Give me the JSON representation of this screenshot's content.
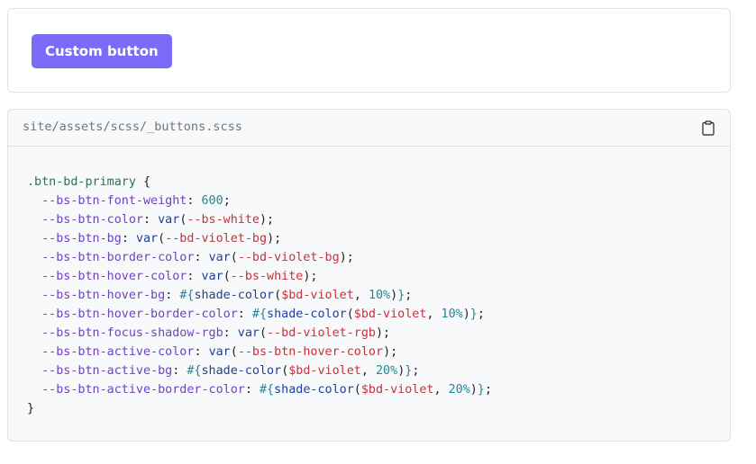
{
  "example": {
    "button_label": "Custom button",
    "button_color": "#7c6af9"
  },
  "code": {
    "filename": "site/assets/scss/_buttons.scss",
    "copy_icon": "clipboard-icon",
    "lines": [
      [
        {
          "t": "sel",
          "v": ".btn-bd-primary"
        },
        {
          "t": "pun",
          "v": " {"
        }
      ],
      [
        {
          "t": "pun",
          "v": "  "
        },
        {
          "t": "prop",
          "v": "--bs-btn-font-weight"
        },
        {
          "t": "pun",
          "v": ": "
        },
        {
          "t": "num",
          "v": "600"
        },
        {
          "t": "pun",
          "v": ";"
        }
      ],
      [
        {
          "t": "pun",
          "v": "  "
        },
        {
          "t": "prop",
          "v": "--bs-btn-color"
        },
        {
          "t": "pun",
          "v": ": "
        },
        {
          "t": "fn",
          "v": "var"
        },
        {
          "t": "pun",
          "v": "("
        },
        {
          "t": "str",
          "v": "--bs-white"
        },
        {
          "t": "pun",
          "v": ");"
        }
      ],
      [
        {
          "t": "pun",
          "v": "  "
        },
        {
          "t": "prop",
          "v": "--bs-btn-bg"
        },
        {
          "t": "pun",
          "v": ": "
        },
        {
          "t": "fn",
          "v": "var"
        },
        {
          "t": "pun",
          "v": "("
        },
        {
          "t": "str",
          "v": "--bd-violet-bg"
        },
        {
          "t": "pun",
          "v": ");"
        }
      ],
      [
        {
          "t": "pun",
          "v": "  "
        },
        {
          "t": "prop",
          "v": "--bs-btn-border-color"
        },
        {
          "t": "pun",
          "v": ": "
        },
        {
          "t": "fn",
          "v": "var"
        },
        {
          "t": "pun",
          "v": "("
        },
        {
          "t": "str",
          "v": "--bd-violet-bg"
        },
        {
          "t": "pun",
          "v": ");"
        }
      ],
      [
        {
          "t": "pun",
          "v": "  "
        },
        {
          "t": "prop",
          "v": "--bs-btn-hover-color"
        },
        {
          "t": "pun",
          "v": ": "
        },
        {
          "t": "fn",
          "v": "var"
        },
        {
          "t": "pun",
          "v": "("
        },
        {
          "t": "str",
          "v": "--bs-white"
        },
        {
          "t": "pun",
          "v": ");"
        }
      ],
      [
        {
          "t": "pun",
          "v": "  "
        },
        {
          "t": "prop",
          "v": "--bs-btn-hover-bg"
        },
        {
          "t": "pun",
          "v": ": "
        },
        {
          "t": "interp",
          "v": "#{"
        },
        {
          "t": "fn",
          "v": "shade-color"
        },
        {
          "t": "pun",
          "v": "("
        },
        {
          "t": "str",
          "v": "$bd-violet"
        },
        {
          "t": "pun",
          "v": ", "
        },
        {
          "t": "num",
          "v": "10%"
        },
        {
          "t": "pun",
          "v": ")"
        },
        {
          "t": "interp",
          "v": "}"
        },
        {
          "t": "pun",
          "v": ";"
        }
      ],
      [
        {
          "t": "pun",
          "v": "  "
        },
        {
          "t": "prop",
          "v": "--bs-btn-hover-border-color"
        },
        {
          "t": "pun",
          "v": ": "
        },
        {
          "t": "interp",
          "v": "#{"
        },
        {
          "t": "fn",
          "v": "shade-color"
        },
        {
          "t": "pun",
          "v": "("
        },
        {
          "t": "str",
          "v": "$bd-violet"
        },
        {
          "t": "pun",
          "v": ", "
        },
        {
          "t": "num",
          "v": "10%"
        },
        {
          "t": "pun",
          "v": ")"
        },
        {
          "t": "interp",
          "v": "}"
        },
        {
          "t": "pun",
          "v": ";"
        }
      ],
      [
        {
          "t": "pun",
          "v": "  "
        },
        {
          "t": "prop",
          "v": "--bs-btn-focus-shadow-rgb"
        },
        {
          "t": "pun",
          "v": ": "
        },
        {
          "t": "fn",
          "v": "var"
        },
        {
          "t": "pun",
          "v": "("
        },
        {
          "t": "str",
          "v": "--bd-violet-rgb"
        },
        {
          "t": "pun",
          "v": ");"
        }
      ],
      [
        {
          "t": "pun",
          "v": "  "
        },
        {
          "t": "prop",
          "v": "--bs-btn-active-color"
        },
        {
          "t": "pun",
          "v": ": "
        },
        {
          "t": "fn",
          "v": "var"
        },
        {
          "t": "pun",
          "v": "("
        },
        {
          "t": "str",
          "v": "--bs-btn-hover-color"
        },
        {
          "t": "pun",
          "v": ");"
        }
      ],
      [
        {
          "t": "pun",
          "v": "  "
        },
        {
          "t": "prop",
          "v": "--bs-btn-active-bg"
        },
        {
          "t": "pun",
          "v": ": "
        },
        {
          "t": "interp",
          "v": "#{"
        },
        {
          "t": "fn",
          "v": "shade-color"
        },
        {
          "t": "pun",
          "v": "("
        },
        {
          "t": "str",
          "v": "$bd-violet"
        },
        {
          "t": "pun",
          "v": ", "
        },
        {
          "t": "num",
          "v": "20%"
        },
        {
          "t": "pun",
          "v": ")"
        },
        {
          "t": "interp",
          "v": "}"
        },
        {
          "t": "pun",
          "v": ";"
        }
      ],
      [
        {
          "t": "pun",
          "v": "  "
        },
        {
          "t": "prop",
          "v": "--bs-btn-active-border-color"
        },
        {
          "t": "pun",
          "v": ": "
        },
        {
          "t": "interp",
          "v": "#{"
        },
        {
          "t": "fn",
          "v": "shade-color"
        },
        {
          "t": "pun",
          "v": "("
        },
        {
          "t": "str",
          "v": "$bd-violet"
        },
        {
          "t": "pun",
          "v": ", "
        },
        {
          "t": "num",
          "v": "20%"
        },
        {
          "t": "pun",
          "v": ")"
        },
        {
          "t": "interp",
          "v": "}"
        },
        {
          "t": "pun",
          "v": ";"
        }
      ],
      [
        {
          "t": "pun",
          "v": "}"
        }
      ]
    ]
  }
}
